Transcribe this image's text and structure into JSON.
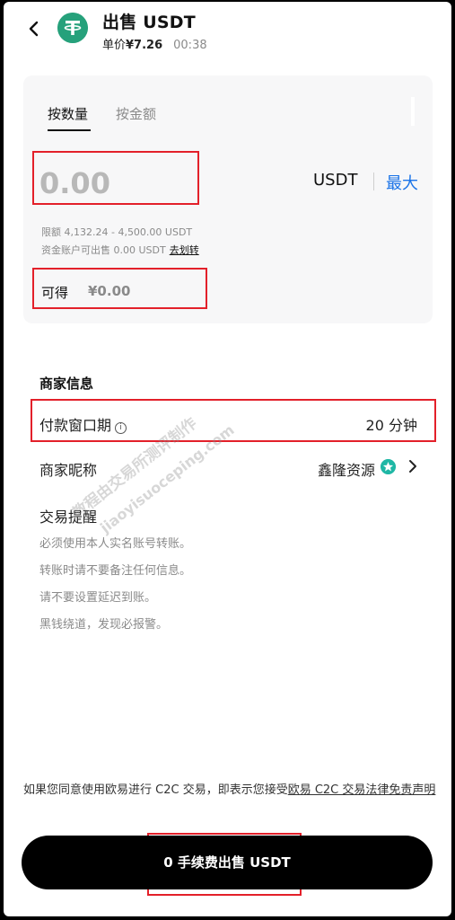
{
  "header": {
    "title": "出售 USDT",
    "price_label": "单价",
    "price": "¥7.26",
    "timer": "00:38",
    "coin_icon": "tether-icon",
    "coin_color": "#26a17b"
  },
  "tabs": [
    {
      "label": "按数量",
      "active": true
    },
    {
      "label": "按金额",
      "active": false
    }
  ],
  "amount": {
    "placeholder": "0.00",
    "unit": "USDT",
    "max_label": "最大",
    "limit_text": "限额 4,132.24 - 4,500.00 USDT",
    "available_text": "资金账户可出售  0.00 USDT",
    "transfer_label": "去划转",
    "receive_label": "可得",
    "receive_value": "¥0.00"
  },
  "merchant": {
    "section_title": "商家信息",
    "payment_window_label": "付款窗口期",
    "payment_window_value": "20 分钟",
    "nickname_label": "商家昵称",
    "nickname_value": "鑫隆资源",
    "tips_title": "交易提醒",
    "tips": [
      "必须使用本人实名账号转账。",
      "转账时请不要备注任何信息。",
      "请不要设置延迟到账。",
      "黑钱绕道，发现必报警。"
    ]
  },
  "watermark": {
    "line1": "教程由交易所测评制作",
    "line2": "jiaoyisuoceping.com"
  },
  "footer": {
    "legal_prefix": "如果您同意使用欧易进行 C2C 交易，即表示您接受",
    "legal_link": "欧易 C2C 交易法律免责声明",
    "cta_label": "0 手续费出售 USDT"
  },
  "colors": {
    "accent": "#1a73e8",
    "highlight": "#e3202a",
    "badge": "#1fb7a5"
  }
}
